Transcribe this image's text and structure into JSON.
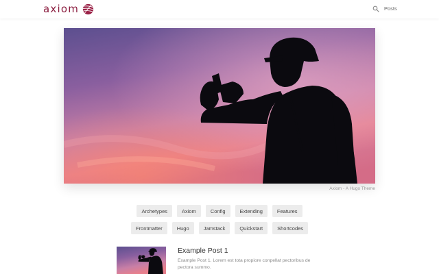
{
  "header": {
    "brand": "axiom",
    "logo_icon": "axiom-sphere-icon",
    "search_icon": "search-icon",
    "nav": [
      {
        "label": "Posts"
      }
    ],
    "colors": {
      "brand": "#8b1d3f"
    }
  },
  "hero": {
    "image": "silhouette-photographer-at-sunset",
    "caption": "Axiom - A Hugo Theme"
  },
  "tags": {
    "row1": [
      "Archetypes",
      "Axiom",
      "Config",
      "Extending",
      "Features"
    ],
    "row2": [
      "Frontmatter",
      "Hugo",
      "Jamstack",
      "Quickstart",
      "Shortcodes"
    ]
  },
  "posts": [
    {
      "title": "Example Post 1",
      "summary": "Example Post 1. Lorem est tota propiore conpellat pectoribus de pectora summo.",
      "thumbnail": "silhouette-photographer-at-sunset"
    }
  ]
}
